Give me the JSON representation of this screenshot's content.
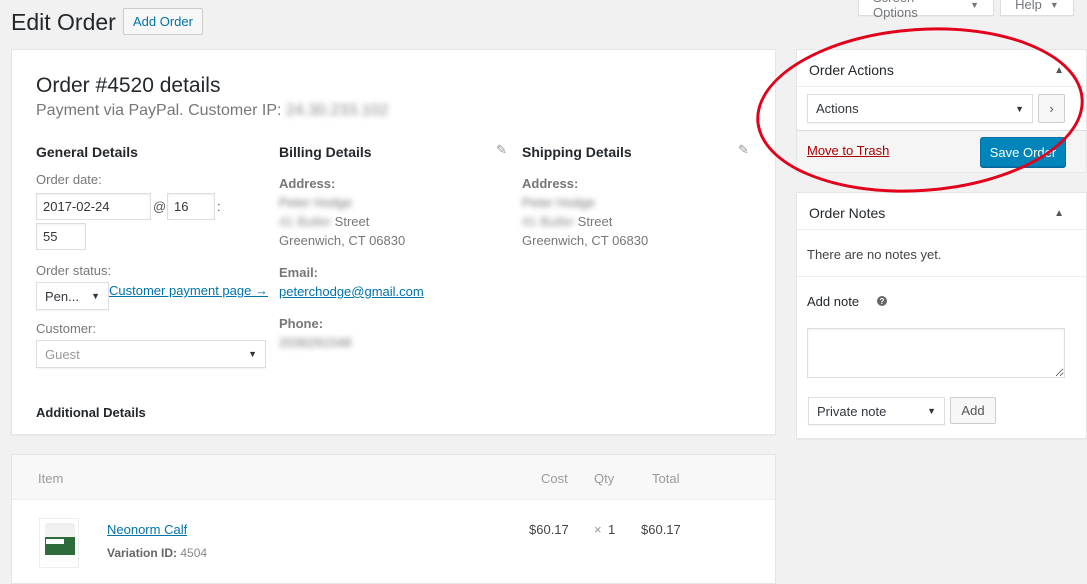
{
  "header": {
    "screen_options_label": "Screen Options",
    "help_label": "Help",
    "page_title": "Edit Order",
    "add_order_label": "Add Order"
  },
  "order": {
    "heading": "Order #4520 details",
    "payment_prefix": "Payment via PayPal. Customer IP:",
    "customer_ip_blurred": "24.30.233.102",
    "general": {
      "title": "General Details",
      "order_date_label": "Order date:",
      "date_value": "2017-02-24",
      "at_sep": "@",
      "hour_value": "16",
      "colon_sep": ":",
      "minute_value": "55",
      "status_label": "Order status:",
      "status_value": "Pen...",
      "customer_payment_link": "Customer payment page →",
      "customer_label": "Customer:",
      "customer_value": "Guest"
    },
    "billing": {
      "title": "Billing Details",
      "address_label": "Address:",
      "name_blurred": "Peter Hodge",
      "street_blurred": "41 Butler",
      "street_suffix": "Street",
      "city": "Greenwich, CT 06830",
      "email_label": "Email:",
      "email": "peterchodge@gmail.com",
      "phone_label": "Phone:",
      "phone_blurred": "2036291548"
    },
    "shipping": {
      "title": "Shipping Details",
      "address_label": "Address:",
      "name_blurred": "Peter Hodge",
      "street_blurred": "41 Butler",
      "street_suffix": "Street",
      "city": "Greenwich, CT 06830"
    },
    "additional_title": "Additional Details"
  },
  "items": {
    "headers": {
      "item": "Item",
      "cost": "Cost",
      "qty": "Qty",
      "total": "Total"
    },
    "rows": [
      {
        "name": "Neonorm Calf",
        "variation_label": "Variation ID:",
        "variation_id": "4504",
        "cost": "$60.17",
        "times": "×",
        "qty": "1",
        "total": "$60.17"
      }
    ]
  },
  "order_actions": {
    "title": "Order Actions",
    "select_value": "Actions",
    "go_icon": "chevron-right-icon",
    "trash_label": "Move to Trash",
    "save_label": "Save Order"
  },
  "order_notes": {
    "title": "Order Notes",
    "empty_text": "There are no notes yet.",
    "add_note_label": "Add note",
    "help_glyph": "?",
    "note_type_value": "Private note",
    "add_button_label": "Add"
  },
  "colors": {
    "primary": "#0085ba",
    "link": "#0073aa",
    "trash": "#a00",
    "annotation": "#e3001b"
  }
}
